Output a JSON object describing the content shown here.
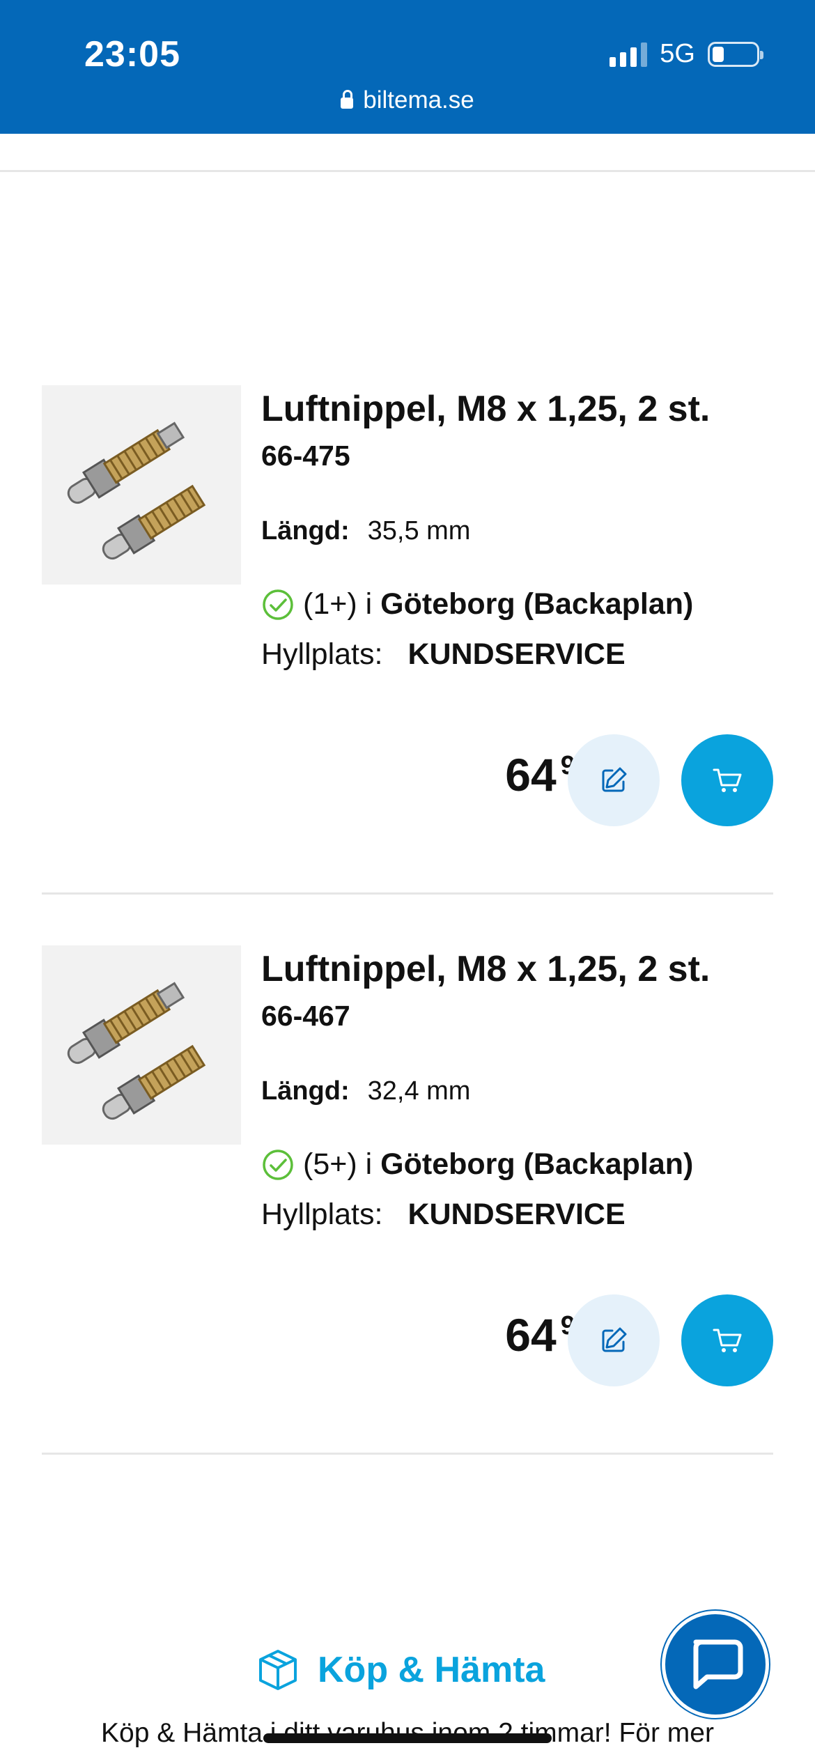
{
  "status_bar": {
    "time": "23:05",
    "network": "5G"
  },
  "browser": {
    "url": "biltema.se"
  },
  "products": [
    {
      "title": "Luftnippel, M8 x 1,25, 2 st.",
      "sku": "66-475",
      "length_label": "Längd:",
      "length_value": "35,5 mm",
      "stock_count": "(1+) i",
      "store": "Göteborg (Backaplan)",
      "shelf_label": "Hyllplats:",
      "shelf_value": "KUNDSERVICE",
      "price_int": "64",
      "price_dec": "90"
    },
    {
      "title": "Luftnippel, M8 x 1,25, 2 st.",
      "sku": "66-467",
      "length_label": "Längd:",
      "length_value": "32,4 mm",
      "stock_count": "(5+) i",
      "store": "Göteborg (Backaplan)",
      "shelf_label": "Hyllplats:",
      "shelf_value": "KUNDSERVICE",
      "price_int": "64",
      "price_dec": "90"
    }
  ],
  "kop_hamta": {
    "heading": "Köp & Hämta",
    "text": "Köp & Hämta i ditt varuhus inom 2 timmar! För mer"
  },
  "icons": {
    "edit": "edit-icon",
    "cart": "cart-icon",
    "check": "check-circle-icon",
    "box": "box-icon",
    "chat": "chat-icon",
    "lock": "lock-icon"
  },
  "colors": {
    "header_blue": "#0468b8",
    "accent_cyan": "#0aa3dd",
    "edit_bg": "#e5f1fa",
    "check_green": "#5cbf3a"
  }
}
